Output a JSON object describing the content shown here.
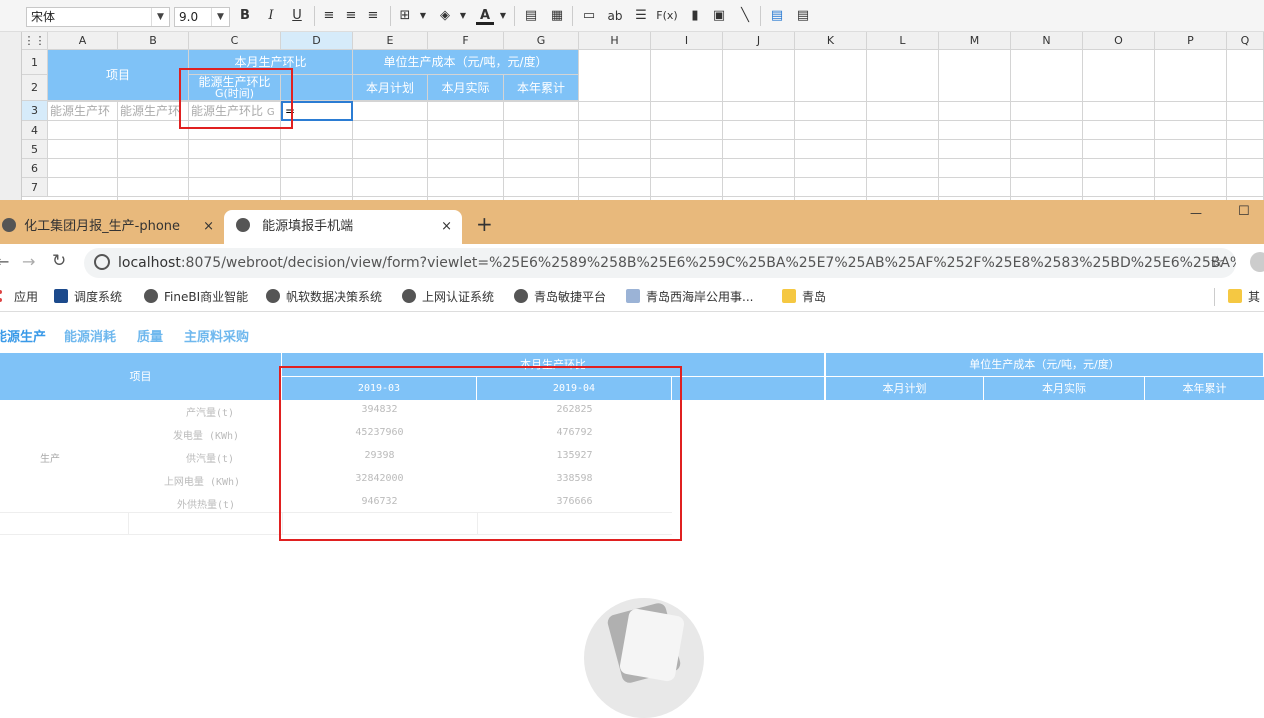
{
  "toolbar": {
    "font_name": "宋体",
    "font_size": "9.0",
    "bold": "B",
    "italic": "I",
    "underline": "U",
    "text_a": "ab",
    "formula": "F(x)",
    "font_color": "A"
  },
  "sheet": {
    "columns": [
      "A",
      "B",
      "C",
      "D",
      "E",
      "F",
      "G",
      "H",
      "I",
      "J",
      "K",
      "L",
      "M",
      "N",
      "O",
      "P",
      "Q"
    ],
    "rows": [
      "1",
      "2",
      "3",
      "4",
      "5",
      "6",
      "7"
    ],
    "header_item": "项目",
    "header_monthly": "本月生产环比",
    "header_energy": "能源生产环比",
    "header_energy_sub": "G(时间)",
    "header_unit_cost": "单位生产成本（元/吨，元/度）",
    "sub_plan": "本月计划",
    "sub_actual": "本月实际",
    "sub_ytd": "本年累计",
    "r3_a": "能源生产环",
    "r3_b": "能源生产环",
    "r3_c": "能源生产环比",
    "r3_c_suffix": "G",
    "r3_d": "="
  },
  "browser": {
    "tabs": [
      {
        "title": "化工集团月报_生产-phone",
        "close": "×"
      },
      {
        "title": "能源填报手机端",
        "close": "×"
      }
    ],
    "new_tab": "+",
    "minimize": "—",
    "maximize": "☐",
    "url_host": "localhost",
    "url_rest": ":8075/webroot/decision/view/form?viewlet=%25E6%2589%258B%25E6%259C%25BA%25E7%25AB%25AF%252F%25E8%2583%25BD%25E6%25BA%2..."
  },
  "bookmarks": [
    "应用",
    "调度系统",
    "FineBI商业智能",
    "帆软数据决策系统",
    "上网认证系统",
    "青岛敏捷平台",
    "青岛西海岸公用事...",
    "青岛",
    "其"
  ],
  "report": {
    "nav": [
      "能源生产",
      "能源消耗",
      "质量",
      "主原料采购"
    ],
    "header_item": "项目",
    "header_monthly": "本月生产环比",
    "header_unit_cost": "单位生产成本（元/吨，元/度）",
    "periods": [
      "2019-03",
      "2019-04"
    ],
    "sub_plan": "本月计划",
    "sub_actual": "本月实际",
    "sub_ytd": "本年累计",
    "group": "生产",
    "rows": [
      {
        "label": "产汽量(t)",
        "v1": "394832",
        "v2": "262825"
      },
      {
        "label": "发电量 (KWh)",
        "v1": "45237960",
        "v2": "476792"
      },
      {
        "label": "供汽量(t)",
        "v1": "29398",
        "v2": "135927"
      },
      {
        "label": "上网电量 (KWh)",
        "v1": "32842000",
        "v2": "338598"
      },
      {
        "label": "外供热量(t)",
        "v1": "946732",
        "v2": "376666"
      }
    ]
  }
}
